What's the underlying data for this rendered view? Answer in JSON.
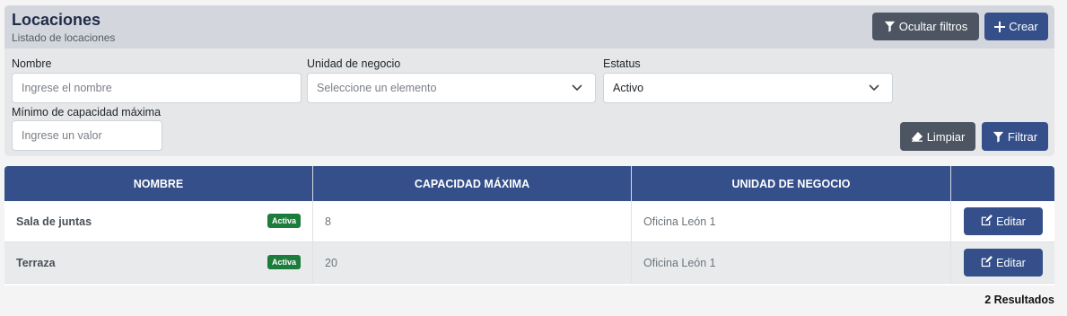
{
  "header": {
    "title": "Locaciones",
    "subtitle": "Listado de locaciones",
    "hide_filters_label": "Ocultar filtros",
    "create_label": "Crear"
  },
  "filters": {
    "name": {
      "label": "Nombre",
      "placeholder": "Ingrese el nombre",
      "value": ""
    },
    "business_unit": {
      "label": "Unidad de negocio",
      "placeholder": "Seleccione un elemento",
      "value": ""
    },
    "status": {
      "label": "Estatus",
      "value": "Activo"
    },
    "min_capacity": {
      "label": "Mínimo de capacidad máxima",
      "placeholder": "Ingrese un valor",
      "value": ""
    },
    "clear_label": "Limpiar",
    "filter_label": "Filtrar"
  },
  "table": {
    "columns": [
      "NOMBRE",
      "CAPACIDAD MÁXIMA",
      "UNIDAD DE NEGOCIO",
      ""
    ],
    "rows": [
      {
        "name": "Sala de juntas",
        "badge": "Activa",
        "capacity": "8",
        "business_unit": "Oficina León 1",
        "action": "Editar"
      },
      {
        "name": "Terraza",
        "badge": "Activa",
        "capacity": "20",
        "business_unit": "Oficina León 1",
        "action": "Editar"
      }
    ],
    "results": "2 Resultados"
  },
  "colors": {
    "primary": "#344f89",
    "secondary": "#4d5562",
    "success_badge": "#1c7c3c"
  },
  "icons": {
    "hide_filters": "filter-icon",
    "create": "plus-icon",
    "clear": "eraser-icon",
    "filter": "filter-icon",
    "edit": "edit-icon",
    "select": "chevron-down-icon"
  }
}
